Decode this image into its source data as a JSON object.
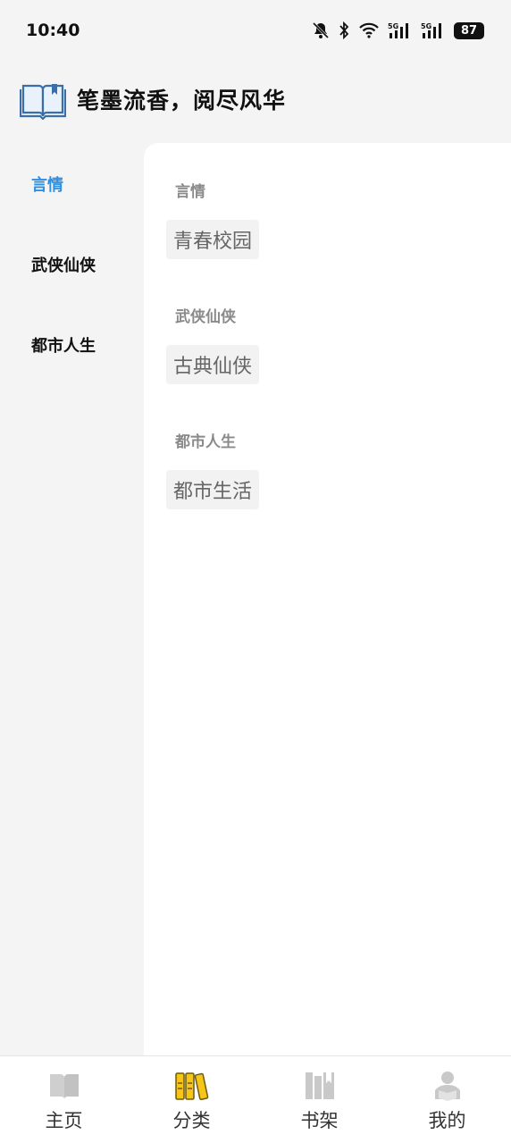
{
  "status_bar": {
    "time": "10:40",
    "battery": "87",
    "icons": [
      "bell-off-icon",
      "bluetooth-icon",
      "wifi-icon",
      "signal-5g-icon",
      "signal-5g-icon"
    ]
  },
  "header": {
    "title": "笔墨流香，阅尽风华",
    "logo_icon": "open-book-icon"
  },
  "sidebar": {
    "items": [
      {
        "label": "言情",
        "active": true
      },
      {
        "label": "武侠仙侠",
        "active": false
      },
      {
        "label": "都市人生",
        "active": false
      }
    ]
  },
  "groups": [
    {
      "title": "言情",
      "tags": [
        "青春校园"
      ]
    },
    {
      "title": "武侠仙侠",
      "tags": [
        "古典仙侠"
      ]
    },
    {
      "title": "都市人生",
      "tags": [
        "都市生活"
      ]
    }
  ],
  "tabbar": {
    "tabs": [
      {
        "label": "主页",
        "icon": "book-open-icon",
        "active": false
      },
      {
        "label": "分类",
        "icon": "category-books-icon",
        "active": true
      },
      {
        "label": "书架",
        "icon": "bookshelf-icon",
        "active": false
      },
      {
        "label": "我的",
        "icon": "user-reading-icon",
        "active": false
      }
    ]
  },
  "colors": {
    "accent": "#2f8fe0",
    "active_tab_icon": "#f5c518",
    "inactive_icon": "#c9c9c9",
    "page_bg": "#f4f4f4"
  }
}
